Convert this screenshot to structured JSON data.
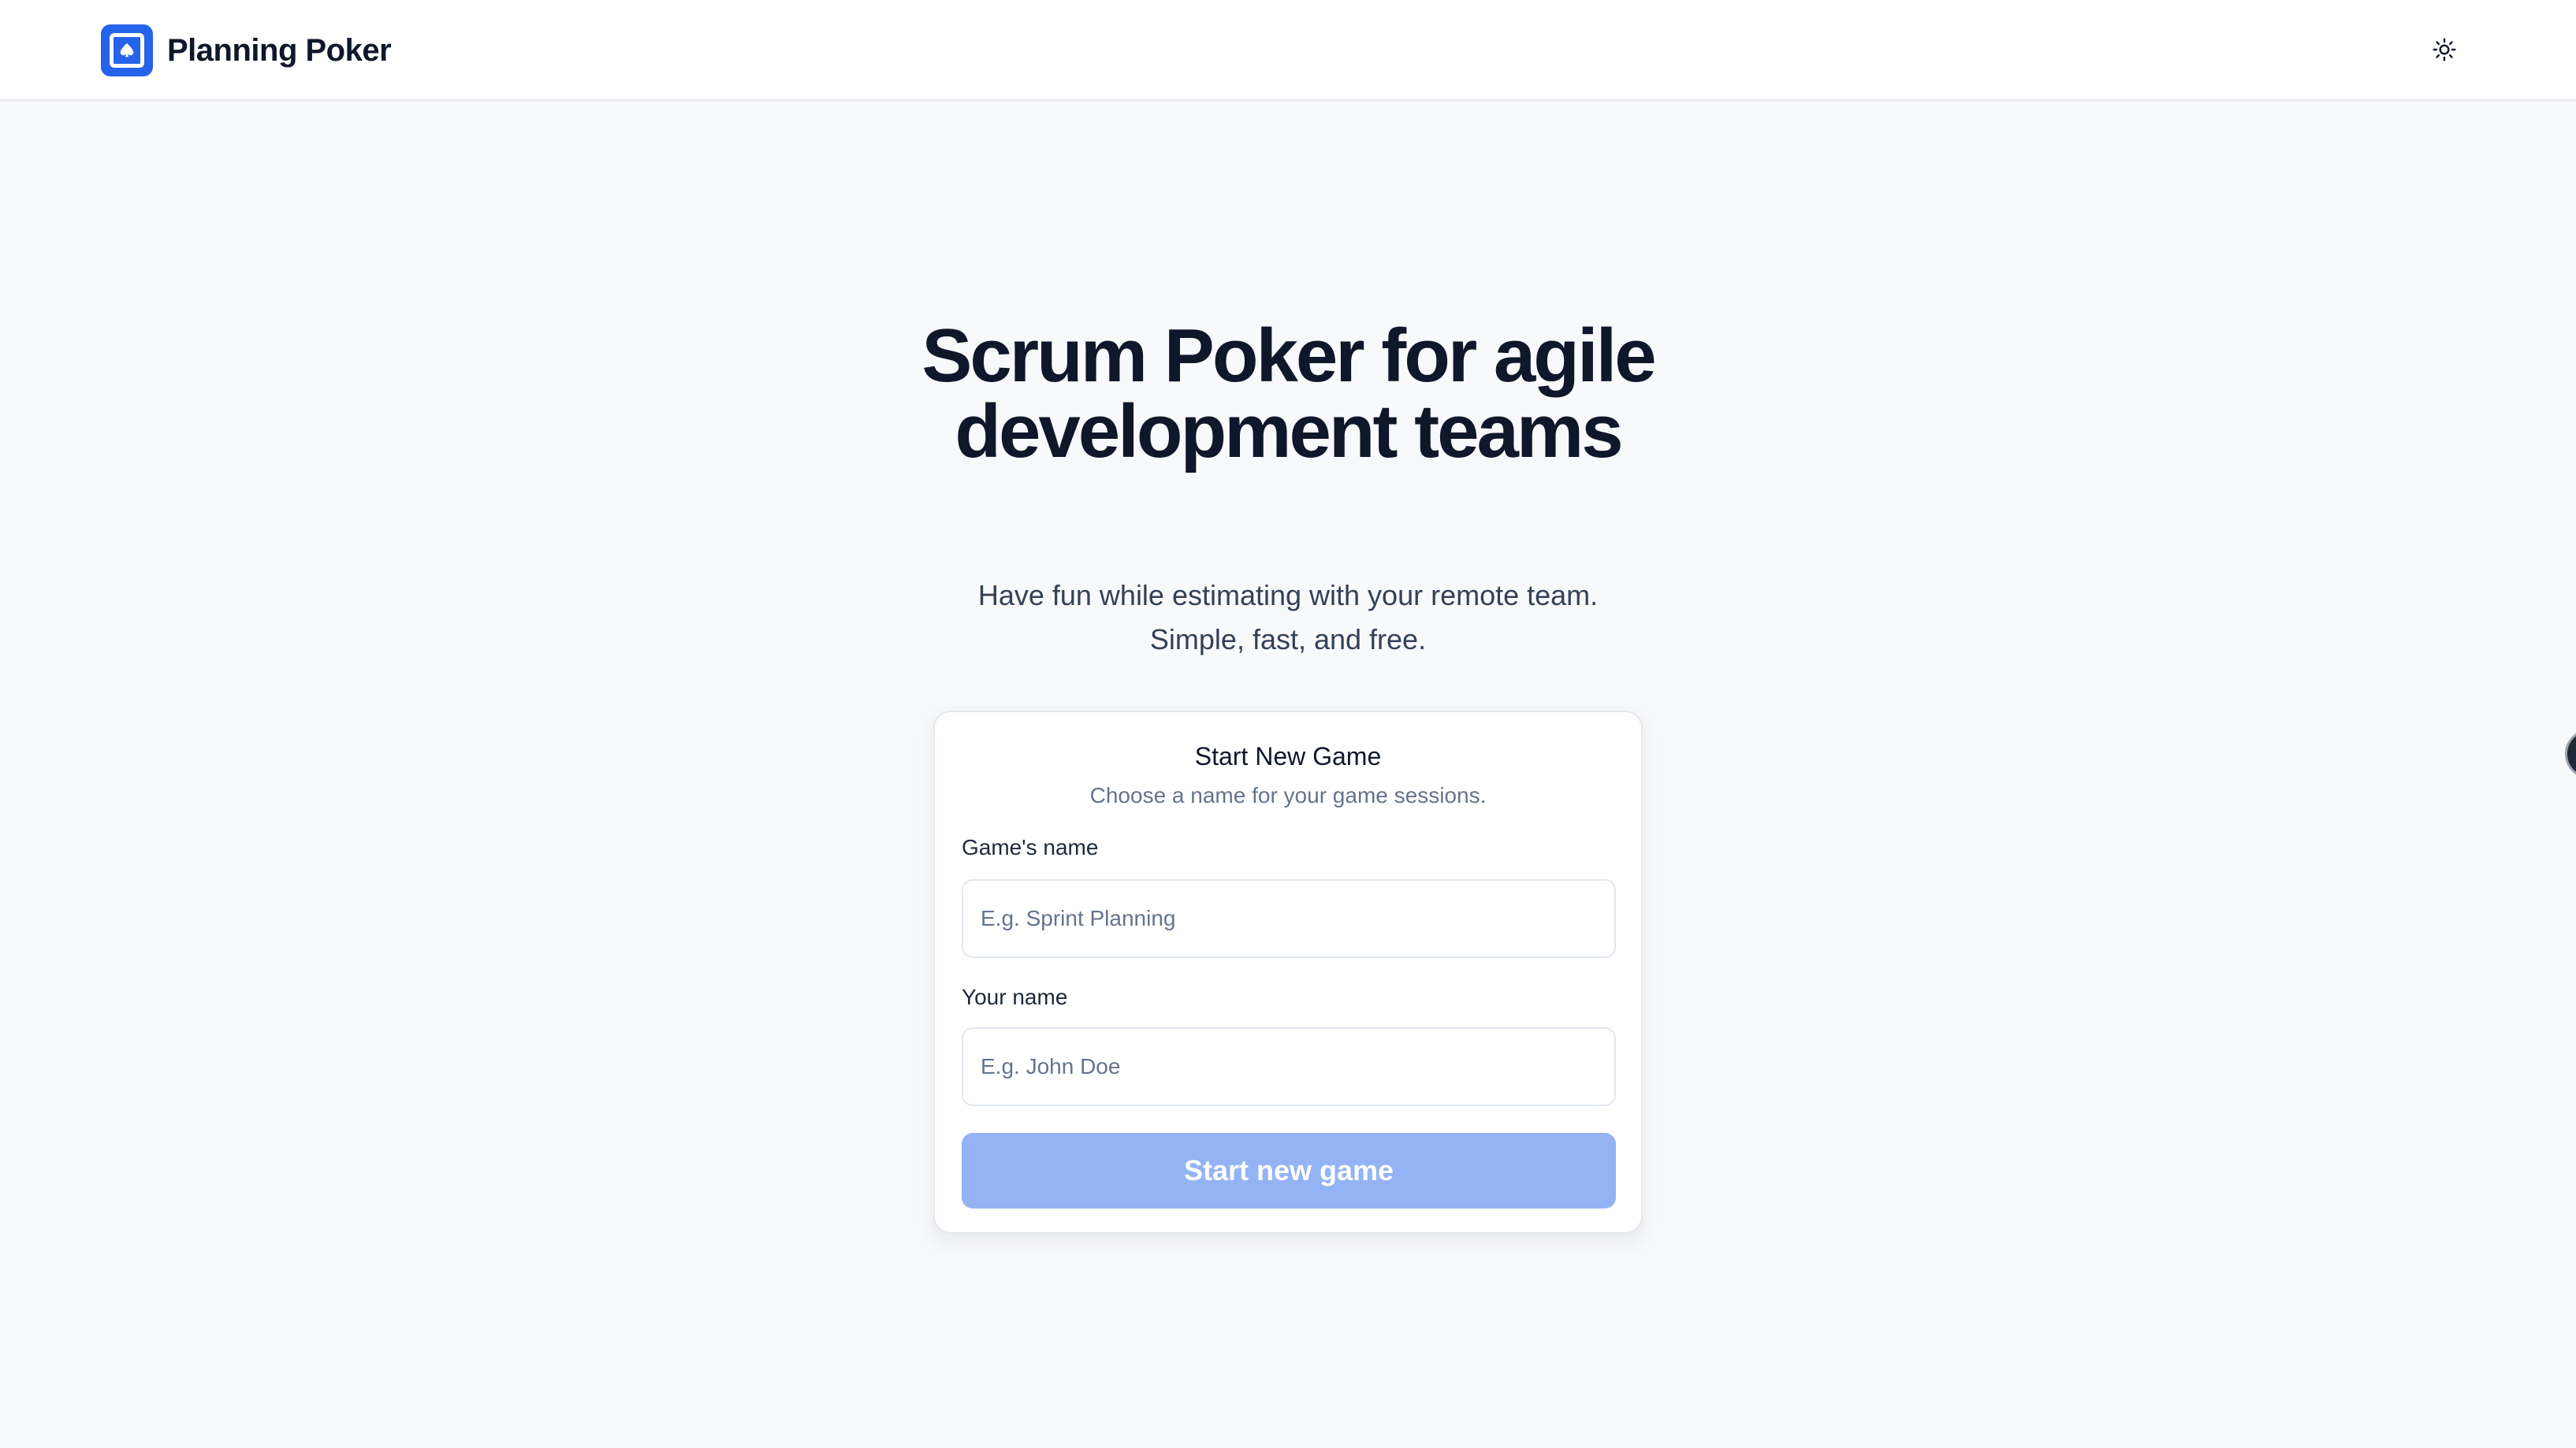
{
  "header": {
    "brand_name": "Planning Poker",
    "logo_icon": "spade-icon",
    "theme_toggle_icon": "sun-icon"
  },
  "hero": {
    "title": "Scrum Poker for agile development teams",
    "subtitle_line1": "Have fun while estimating with your remote team.",
    "subtitle_line2": "Simple, fast, and free."
  },
  "form": {
    "title": "Start New Game",
    "subtitle": "Choose a name for your game sessions.",
    "game_name_label": "Game's name",
    "game_name_placeholder": "E.g. Sprint Planning",
    "game_name_value": "",
    "your_name_label": "Your name",
    "your_name_placeholder": "E.g. John Doe",
    "your_name_value": "",
    "submit_label": "Start new game"
  },
  "colors": {
    "brand": "#2563eb",
    "button_disabled": "#94b3f5",
    "background": "#f8f9fb"
  }
}
